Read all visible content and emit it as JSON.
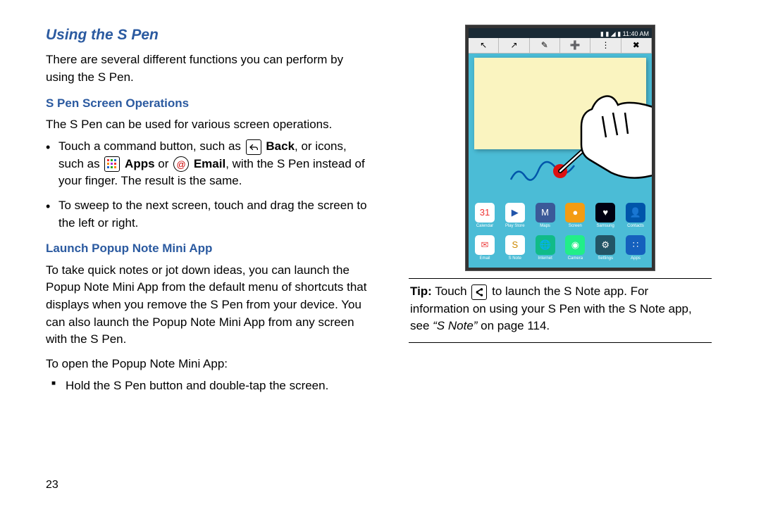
{
  "page_number": "23",
  "headings": {
    "main": "Using the S Pen",
    "sub1": "S Pen Screen Operations",
    "sub2": "Launch Popup Note Mini App"
  },
  "intro": "There are several different functions you can perform by using the S Pen.",
  "sec1_intro": "The S Pen can be used for various screen operations.",
  "bullet1": {
    "p1": "Touch a command button, such as ",
    "back_label": "Back",
    "p2": ", or icons, such as ",
    "apps_label": "Apps",
    "p3": " or ",
    "email_label": "Email",
    "p4": ", with the S Pen instead of your finger. The result is the same."
  },
  "bullet2": "To sweep to the next screen, touch and drag the screen to the left or right.",
  "sec2_para": "To take quick notes or jot down ideas, you can launch the Popup Note Mini App from the default menu of shortcuts that displays when you remove the S Pen from your device. You can also launch the Popup Note Mini App from any screen with the S Pen.",
  "sec2_lead": "To open the Popup Note Mini App:",
  "sec2_step": "Hold the S Pen button and double-tap the screen.",
  "tip": {
    "prefix": "Tip:",
    "p1": " Touch ",
    "p2": " to launch the S Note app. For information on using your S Pen with the S Note app, see ",
    "ref": "“S Note”",
    "p3": " on page 114."
  },
  "device": {
    "status_time": "11:40 AM",
    "toolbar_icons": [
      "↖",
      "↗",
      "✎",
      "➕",
      "⋮",
      "✖"
    ],
    "red_dot_color": "#d11",
    "row1": [
      {
        "bg": "#fff",
        "color": "#e33",
        "glyph": "31",
        "label": "Calendar"
      },
      {
        "bg": "#fff",
        "color": "#25a",
        "glyph": "▶",
        "label": "Play Store"
      },
      {
        "bg": "#3b5998",
        "glyph": "M",
        "label": "Maps"
      },
      {
        "bg": "#f39c12",
        "glyph": "●",
        "label": "Screen"
      },
      {
        "bg": "#001",
        "glyph": "♥",
        "label": "Samsung"
      },
      {
        "bg": "#05a",
        "glyph": "👤",
        "label": "Contacts"
      }
    ],
    "row2": [
      {
        "bg": "#fff",
        "color": "#e44",
        "glyph": "✉",
        "label": "Email"
      },
      {
        "bg": "#fff",
        "color": "#c80",
        "glyph": "S",
        "label": "S Note"
      },
      {
        "bg": "#1b8",
        "glyph": "🌐",
        "label": "Internet"
      },
      {
        "bg": "#2e8",
        "glyph": "◉",
        "label": "Camera"
      },
      {
        "bg": "#256",
        "glyph": "⚙",
        "label": "Settings"
      },
      {
        "bg": "#1560bd",
        "glyph": "∷",
        "label": "Apps"
      }
    ]
  }
}
